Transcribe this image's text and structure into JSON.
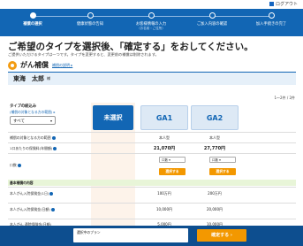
{
  "header": {
    "logout_label": "ログアウト"
  },
  "steps": [
    {
      "label": "補償の選択",
      "sub": "",
      "active": true
    },
    {
      "label": "健康状態の告知",
      "sub": "",
      "active": false
    },
    {
      "label": "お客様情報の入力",
      "sub": "（お名前・ご住所）",
      "active": false
    },
    {
      "label": "ご加入内容の確認",
      "sub": "",
      "active": false
    },
    {
      "label": "加入手続きの完了",
      "sub": "",
      "active": false
    }
  ],
  "page": {
    "headline": "ご希望のタイプを選択後、「確定する」をおしてください。",
    "subline": "ご提供いただけるタイプは一つです。タイプを変更すると、変更前の補償は削除されます。",
    "product_name": "がん補償",
    "product_link": "補償の説明 ▸",
    "insured_name": "東海　太郎",
    "insured_suffix": "様",
    "count": "1～2件 / 2件"
  },
  "filter": {
    "label": "タイプの絞込み",
    "link": "(補償の対象となる方の範囲) ▸",
    "selected": "すべて"
  },
  "columns": {
    "unselected": "未選択",
    "plans": [
      "GA1",
      "GA2"
    ]
  },
  "rows": {
    "scope": {
      "label": "補償の対象となる方の範囲",
      "values": [
        "本人型",
        "本人型"
      ]
    },
    "premium": {
      "label": "1口あたりの保険料(年間額)",
      "values": [
        "21,070円",
        "27,770円"
      ]
    },
    "units_label": "口数",
    "unit_select": [
      "口数",
      "口数"
    ],
    "choose_label": "選択する",
    "section": "基本補償の内容",
    "benefits": [
      {
        "label": "本人がん入院保険金(1日)",
        "values": [
          "100万円",
          "200万円"
        ]
      },
      {
        "label": "本人がん入院保険金(日額)",
        "values": [
          "10,000円",
          "20,000円"
        ]
      },
      {
        "label": "本人がん 通院保険金(日額)",
        "values": [
          "5,000円",
          "10,000円"
        ]
      }
    ]
  },
  "footer": {
    "current_plan_label": "選択中のプラン",
    "confirm_label": "確定する"
  },
  "colors": {
    "primary": "#1266b4",
    "accent": "#f39800",
    "footer": "#0d4e8f"
  }
}
